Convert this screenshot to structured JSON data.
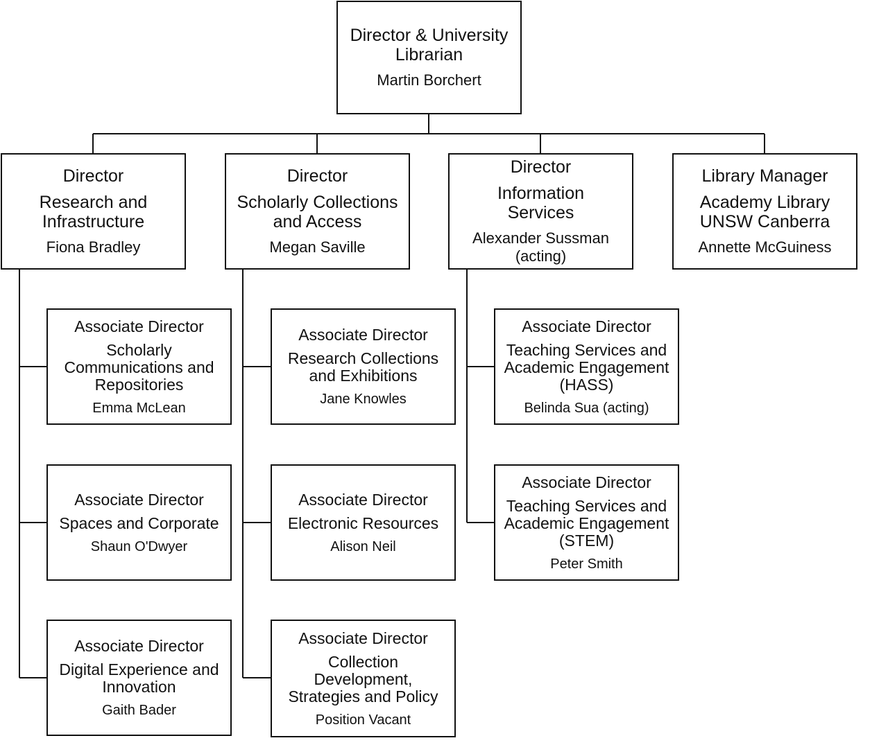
{
  "nodes": [
    {
      "id": "top",
      "title": "Director & University Librarian",
      "unit": "",
      "name": "Martin Borchert"
    },
    {
      "id": "d1",
      "title": "Director",
      "unit": "Research and Infrastructure",
      "name": "Fiona Bradley"
    },
    {
      "id": "d2",
      "title": "Director",
      "unit": "Scholarly Collections and Access",
      "name": "Megan Saville"
    },
    {
      "id": "d3",
      "title": "Director",
      "unit": "Information Services",
      "name": "Alexander Sussman (acting)"
    },
    {
      "id": "d4",
      "title": "Library Manager",
      "unit": "Academy Library UNSW Canberra",
      "name": "Annette McGuiness"
    },
    {
      "id": "a11",
      "title": "Associate Director",
      "unit": "Scholarly Communications and Repositories",
      "name": "Emma McLean"
    },
    {
      "id": "a12",
      "title": "Associate Director",
      "unit": "Spaces and Corporate",
      "name": "Shaun O'Dwyer"
    },
    {
      "id": "a13",
      "title": "Associate Director",
      "unit": "Digital Experience and Innovation",
      "name": "Gaith Bader"
    },
    {
      "id": "a21",
      "title": "Associate Director",
      "unit": "Research Collections and Exhibitions",
      "name": "Jane Knowles"
    },
    {
      "id": "a22",
      "title": "Associate Director",
      "unit": "Electronic Resources",
      "name": "Alison Neil"
    },
    {
      "id": "a23",
      "title": "Associate Director",
      "unit": "Collection Development, Strategies and Policy",
      "name": "Position Vacant"
    },
    {
      "id": "a31",
      "title": "Associate Director",
      "unit": "Teaching Services and Academic Engagement (HASS)",
      "name": "Belinda Sua (acting)"
    },
    {
      "id": "a32",
      "title": "Associate Director",
      "unit": "Teaching Services and Academic Engagement (STEM)",
      "name": "Peter Smith"
    }
  ],
  "colors": {
    "line": "#111111",
    "background": "#ffffff"
  }
}
